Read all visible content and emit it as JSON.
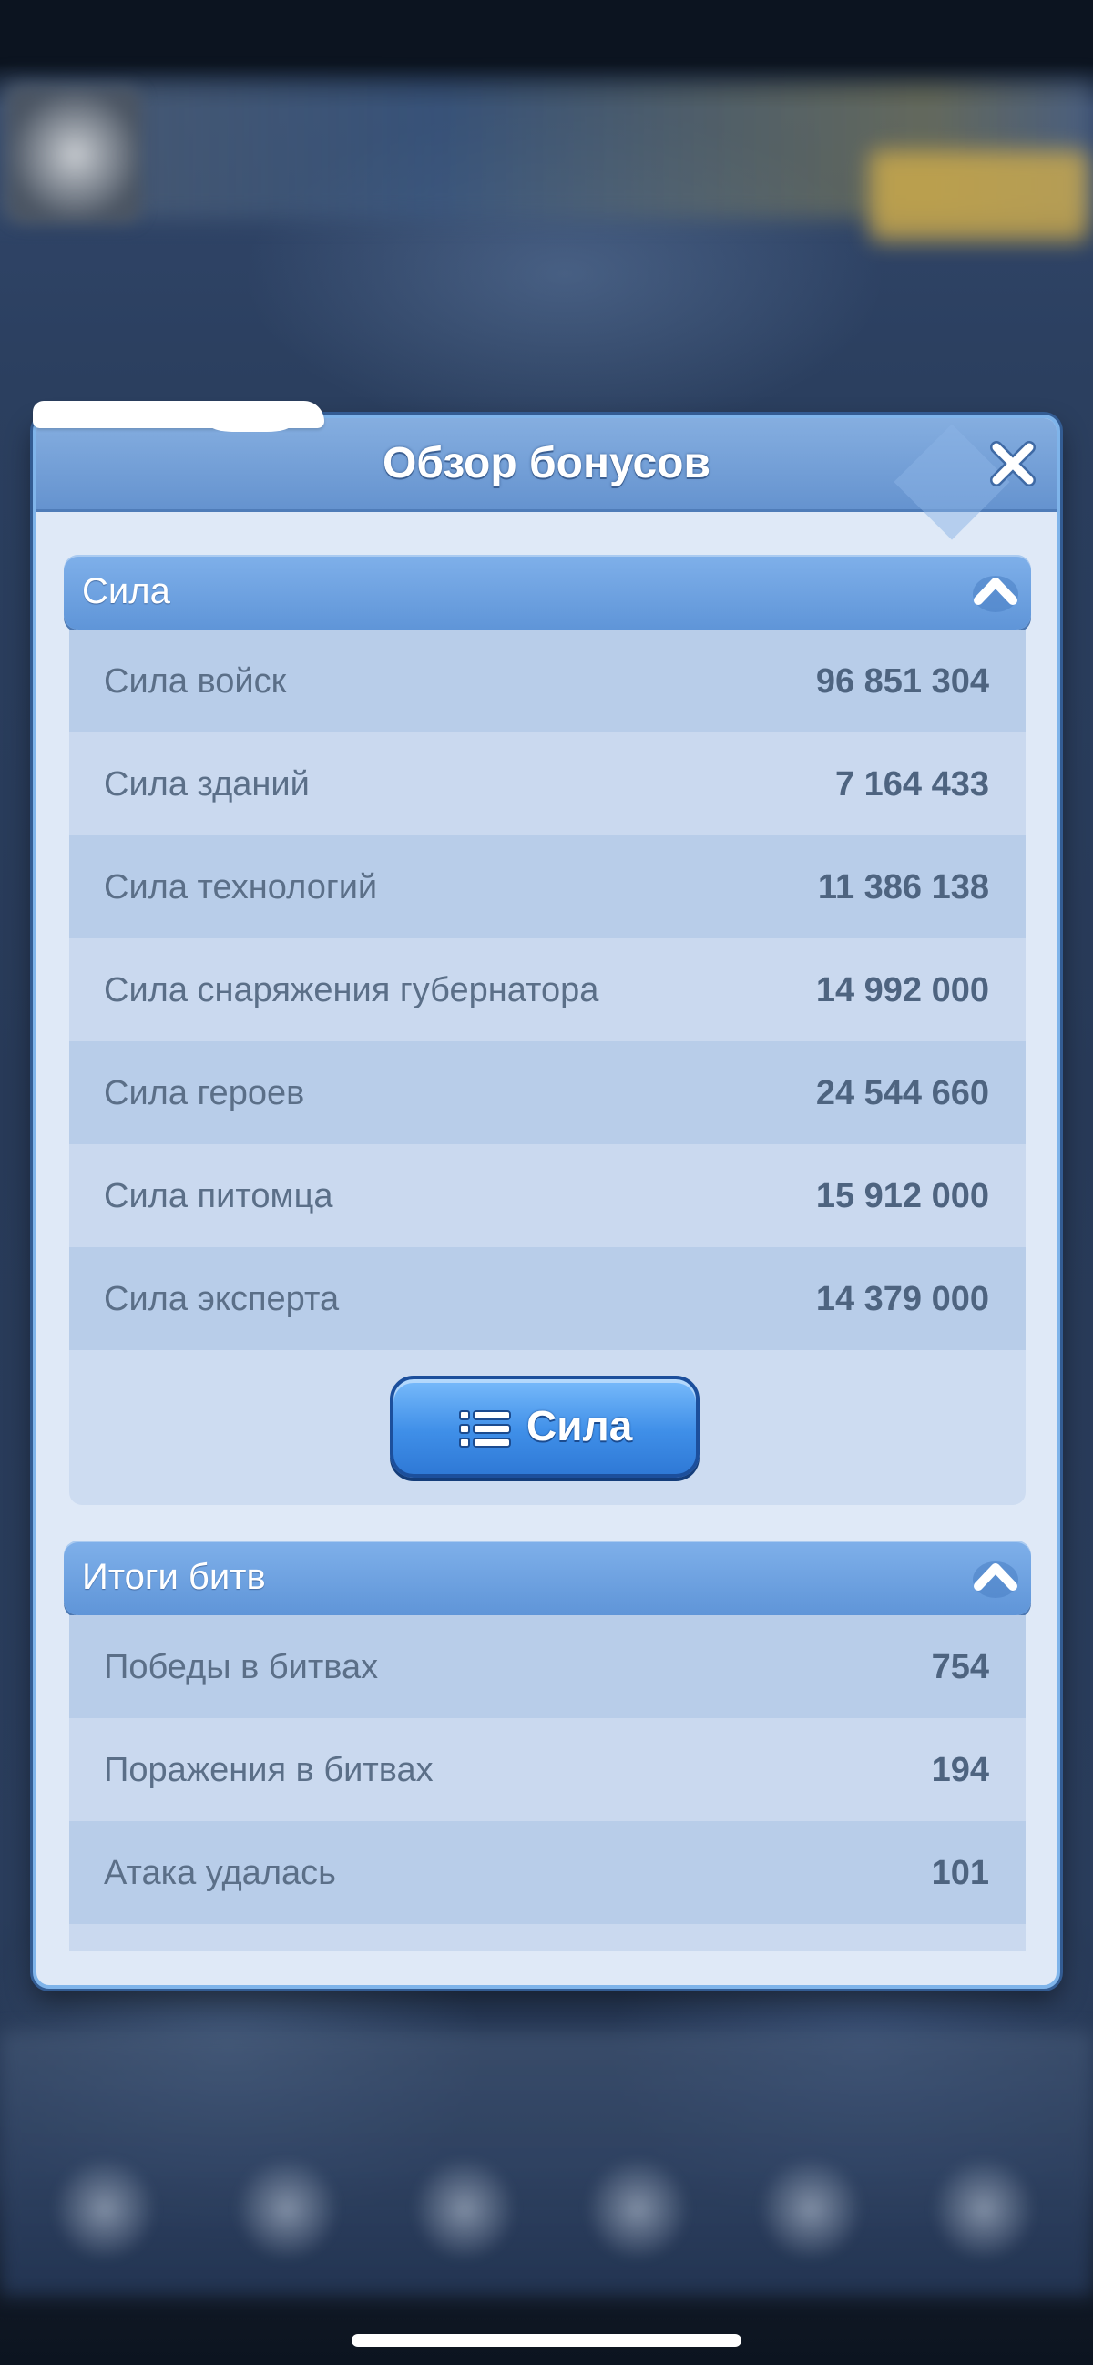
{
  "dialog": {
    "title": "Обзор бонусов",
    "close_icon": "close-icon"
  },
  "power_section": {
    "title": "Сила",
    "collapse_icon": "chevron-up-icon",
    "rows": [
      {
        "label": "Сила войск",
        "value": "96 851 304"
      },
      {
        "label": "Сила зданий",
        "value": "7 164 433"
      },
      {
        "label": "Сила технологий",
        "value": "11 386 138"
      },
      {
        "label": "Сила снаряжения губернатора",
        "value": "14 992 000"
      },
      {
        "label": "Сила героев",
        "value": "24 544 660"
      },
      {
        "label": "Сила питомца",
        "value": "15 912 000"
      },
      {
        "label": "Сила эксперта",
        "value": "14 379 000"
      }
    ],
    "button": {
      "label": "Сила",
      "icon": "list-icon"
    }
  },
  "battle_section": {
    "title": "Итоги битв",
    "collapse_icon": "chevron-up-icon",
    "rows": [
      {
        "label": "Победы в битвах",
        "value": "754"
      },
      {
        "label": "Поражения в битвах",
        "value": "194"
      },
      {
        "label": "Атака удалась",
        "value": "101"
      }
    ]
  },
  "colors": {
    "header": "#6f9bd6",
    "panel": "#dfe9f7",
    "row_dark": "#b8cde9",
    "row_light": "#cad9ef",
    "button": "#3f8fe8"
  }
}
